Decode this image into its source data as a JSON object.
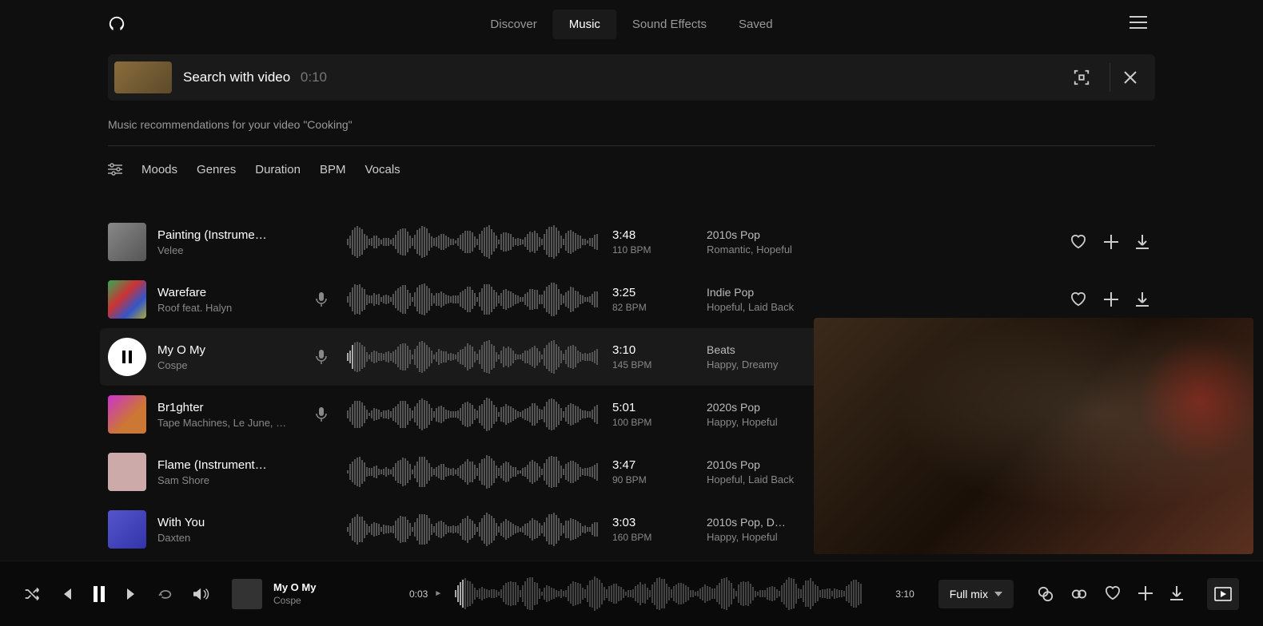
{
  "nav": {
    "items": [
      {
        "label": "Discover"
      },
      {
        "label": "Music"
      },
      {
        "label": "Sound Effects"
      },
      {
        "label": "Saved"
      }
    ],
    "active_index": 1
  },
  "search": {
    "label": "Search with video",
    "duration": "0:10"
  },
  "subtitle": "Music recommendations for your video \"Cooking\"",
  "filters": [
    {
      "label": "Moods"
    },
    {
      "label": "Genres"
    },
    {
      "label": "Duration"
    },
    {
      "label": "BPM"
    },
    {
      "label": "Vocals"
    }
  ],
  "tracks": [
    {
      "title": "Painting (Instrume…",
      "artist": "Velee",
      "has_mic": false,
      "duration": "3:48",
      "bpm": "110 BPM",
      "genre": "2010s Pop",
      "moods": "Romantic, Hopeful",
      "cover_class": "cov1",
      "active": false
    },
    {
      "title": "Warefare",
      "artist": "Roof feat. Halyn",
      "has_mic": true,
      "duration": "3:25",
      "bpm": "82 BPM",
      "genre": "Indie Pop",
      "moods": "Hopeful, Laid Back",
      "cover_class": "cov2",
      "active": false
    },
    {
      "title": "My O My",
      "artist": "Cospe",
      "has_mic": true,
      "duration": "3:10",
      "bpm": "145 BPM",
      "genre": "Beats",
      "moods": "Happy, Dreamy",
      "cover_class": "cov3",
      "active": true
    },
    {
      "title": "Br1ghter",
      "artist": "Tape Machines, Le June, …",
      "has_mic": true,
      "duration": "5:01",
      "bpm": "100 BPM",
      "genre": "2020s Pop",
      "moods": "Happy, Hopeful",
      "cover_class": "cov4",
      "active": false
    },
    {
      "title": "Flame (Instrument…",
      "artist": "Sam Shore",
      "has_mic": false,
      "duration": "3:47",
      "bpm": "90 BPM",
      "genre": "2010s Pop",
      "moods": "Hopeful, Laid Back",
      "cover_class": "cov5",
      "active": false
    },
    {
      "title": "With You",
      "artist": "Daxten",
      "has_mic": false,
      "duration": "3:03",
      "bpm": "160 BPM",
      "genre": "2010s Pop, D…",
      "moods": "Happy, Hopeful",
      "cover_class": "cov6",
      "active": false
    }
  ],
  "player": {
    "title": "My O My",
    "artist": "Cospe",
    "current_time": "0:03",
    "total_time": "3:10",
    "mix_label": "Full mix"
  }
}
